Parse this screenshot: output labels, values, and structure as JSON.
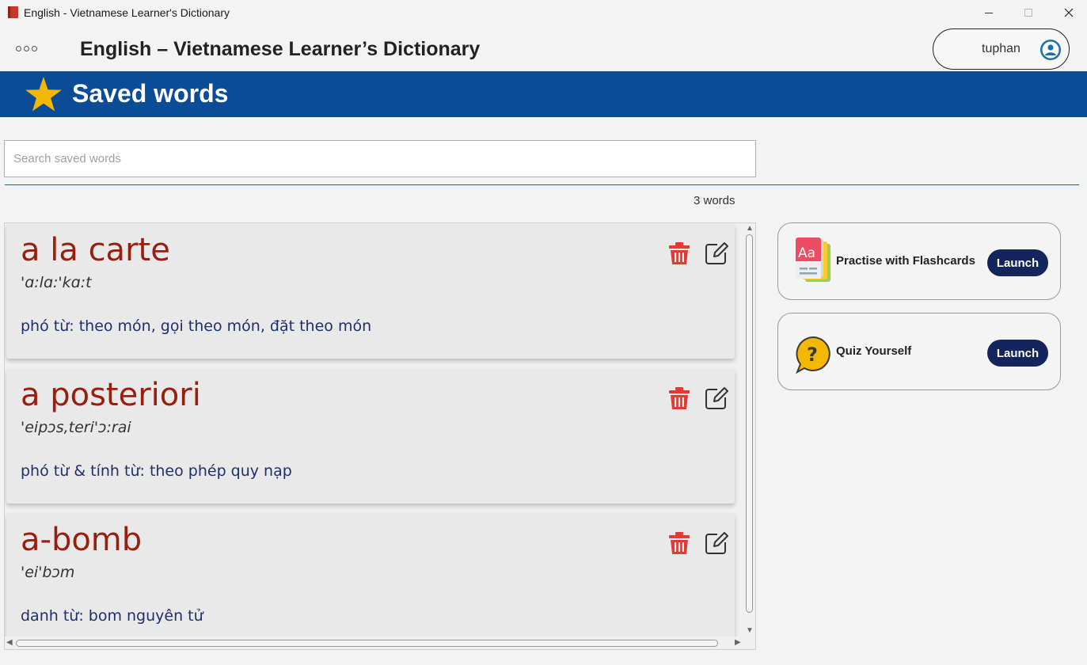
{
  "window": {
    "title": "English - Vietnamese Learner's Dictionary",
    "icon": "book-icon"
  },
  "header": {
    "app_title": "English – Vietnamese Learner’s Dictionary",
    "username": "tuphan"
  },
  "banner": {
    "title": "Saved words",
    "icon": "star-icon"
  },
  "search": {
    "placeholder": "Search saved words",
    "value": ""
  },
  "word_count": "3 words",
  "words": [
    {
      "headword": "a la carte",
      "phonetic": "'ɑ:lɑ:'kɑ:t",
      "definition": "phó từ: theo món, gọi theo món, đặt theo món"
    },
    {
      "headword": "a posteriori",
      "phonetic": "'eipɔs,teri'ɔ:rai",
      "definition": "phó từ & tính từ: theo phép quy nạp"
    },
    {
      "headword": "a-bomb",
      "phonetic": "'ei'bɔm",
      "definition": "danh từ: bom nguyên tử"
    }
  ],
  "features": [
    {
      "label": "Practise with Flashcards",
      "button": "Launch",
      "icon": "flashcards-icon"
    },
    {
      "label": "Quiz Yourself",
      "button": "Launch",
      "icon": "question-bubble-icon"
    }
  ],
  "colors": {
    "banner": "#0b4c96",
    "headword": "#9a1e0e",
    "definition": "#1f2f6b",
    "launch_button": "#14255e",
    "star": "#f5b800",
    "trash": "#e53935"
  }
}
